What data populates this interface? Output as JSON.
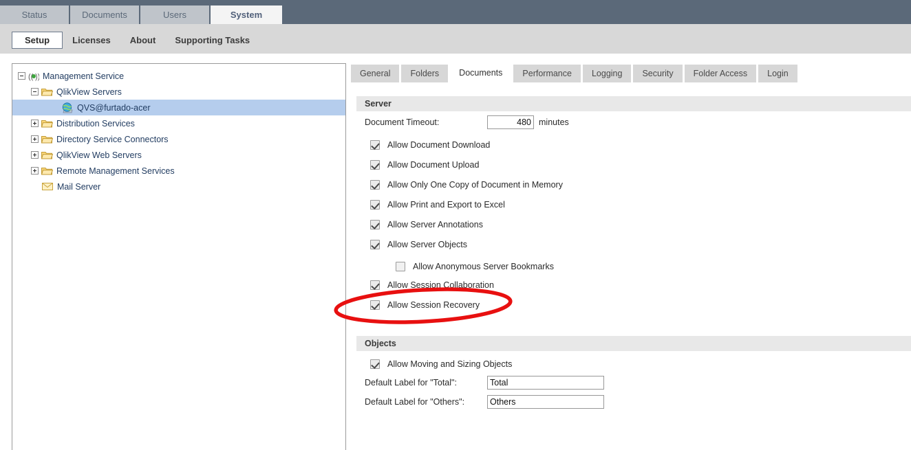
{
  "top_tabs": [
    {
      "label": "Status",
      "active": false
    },
    {
      "label": "Documents",
      "active": false
    },
    {
      "label": "Users",
      "active": false
    },
    {
      "label": "System",
      "active": true
    }
  ],
  "sub_nav": [
    {
      "label": "Setup",
      "active": true
    },
    {
      "label": "Licenses",
      "active": false
    },
    {
      "label": "About",
      "active": false
    },
    {
      "label": "Supporting Tasks",
      "active": false
    }
  ],
  "tree": [
    {
      "label": "Management Service",
      "indent": 0,
      "expander": "minus",
      "icon": "broadcast-icon",
      "selected": false
    },
    {
      "label": "QlikView Servers",
      "indent": 1,
      "expander": "minus",
      "icon": "folder-icon",
      "selected": false
    },
    {
      "label": "QVS@furtado-acer",
      "indent": 2,
      "expander": "none",
      "icon": "server-globe-icon",
      "selected": true
    },
    {
      "label": "Distribution Services",
      "indent": 1,
      "expander": "plus",
      "icon": "folder-icon",
      "selected": false
    },
    {
      "label": "Directory Service Connectors",
      "indent": 1,
      "expander": "plus",
      "icon": "folder-icon",
      "selected": false
    },
    {
      "label": "QlikView Web Servers",
      "indent": 1,
      "expander": "plus",
      "icon": "folder-icon",
      "selected": false
    },
    {
      "label": "Remote Management Services",
      "indent": 1,
      "expander": "plus",
      "icon": "folder-icon",
      "selected": false
    },
    {
      "label": "Mail Server",
      "indent": 1,
      "expander": "none",
      "icon": "mail-icon",
      "selected": false
    }
  ],
  "content_tabs": [
    {
      "label": "General",
      "active": false
    },
    {
      "label": "Folders",
      "active": false
    },
    {
      "label": "Documents",
      "active": true
    },
    {
      "label": "Performance",
      "active": false
    },
    {
      "label": "Logging",
      "active": false
    },
    {
      "label": "Security",
      "active": false
    },
    {
      "label": "Folder Access",
      "active": false
    },
    {
      "label": "Login",
      "active": false
    }
  ],
  "server_section": {
    "title": "Server",
    "document_timeout": {
      "label": "Document Timeout:",
      "value": "480",
      "unit": "minutes"
    },
    "checkboxes": [
      {
        "label": "Allow Document Download",
        "checked": true,
        "indent": 0
      },
      {
        "label": "Allow Document Upload",
        "checked": true,
        "indent": 0
      },
      {
        "label": "Allow Only One Copy of Document in Memory",
        "checked": true,
        "indent": 0
      },
      {
        "label": "Allow Print and Export to Excel",
        "checked": true,
        "indent": 0
      },
      {
        "label": "Allow Server Annotations",
        "checked": true,
        "indent": 0
      },
      {
        "label": "Allow Server Objects",
        "checked": true,
        "indent": 0
      },
      {
        "label": "Allow Anonymous Server Bookmarks",
        "checked": false,
        "indent": 1
      },
      {
        "label": "Allow Session Collaboration",
        "checked": true,
        "indent": 0
      },
      {
        "label": "Allow Session Recovery",
        "checked": true,
        "indent": 0
      }
    ]
  },
  "objects_section": {
    "title": "Objects",
    "allow_moving": {
      "label": "Allow Moving and Sizing Objects",
      "checked": true
    },
    "default_total": {
      "label": "Default Label for \"Total\":",
      "value": "Total"
    },
    "default_others": {
      "label": "Default Label for \"Others\":",
      "value": "Others"
    }
  },
  "annotation": {
    "shape": "ellipse",
    "color": "#e81010",
    "targets": "Allow Session Recovery"
  },
  "colors": {
    "header_bar": "#5b6979",
    "inactive_tab": "#bfc4ca",
    "subnav_bar": "#d8d8d8",
    "tree_selection": "#b5cded",
    "section_header": "#e8e8e8",
    "annotation_red": "#e81010"
  }
}
